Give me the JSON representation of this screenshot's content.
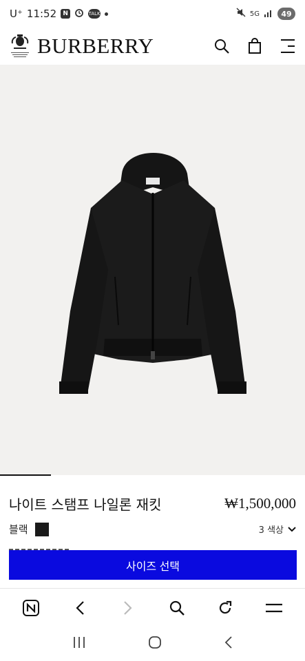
{
  "status_bar": {
    "carrier": "U⁺",
    "time": "11:52",
    "network": "5G",
    "battery": "49"
  },
  "header": {
    "brand": "BURBERRY"
  },
  "product": {
    "title": "나이트 스탬프 나일론 재킷",
    "price": "₩1,500,000",
    "color_label": "블랙",
    "color_count": "3 색상",
    "size_button": "사이즈 선택"
  },
  "icons": {
    "header": [
      "search-icon",
      "shopping-bag-icon",
      "menu-icon"
    ],
    "browser": [
      "naver-home-icon",
      "back-icon",
      "forward-icon",
      "search-icon",
      "reload-icon",
      "menu-icon"
    ],
    "system": [
      "recent-apps-icon",
      "home-icon",
      "back-icon"
    ]
  },
  "colors": {
    "accent_button": "#0a0adf",
    "image_background": "#f2f1ef",
    "swatch": "#1a1a1a"
  }
}
